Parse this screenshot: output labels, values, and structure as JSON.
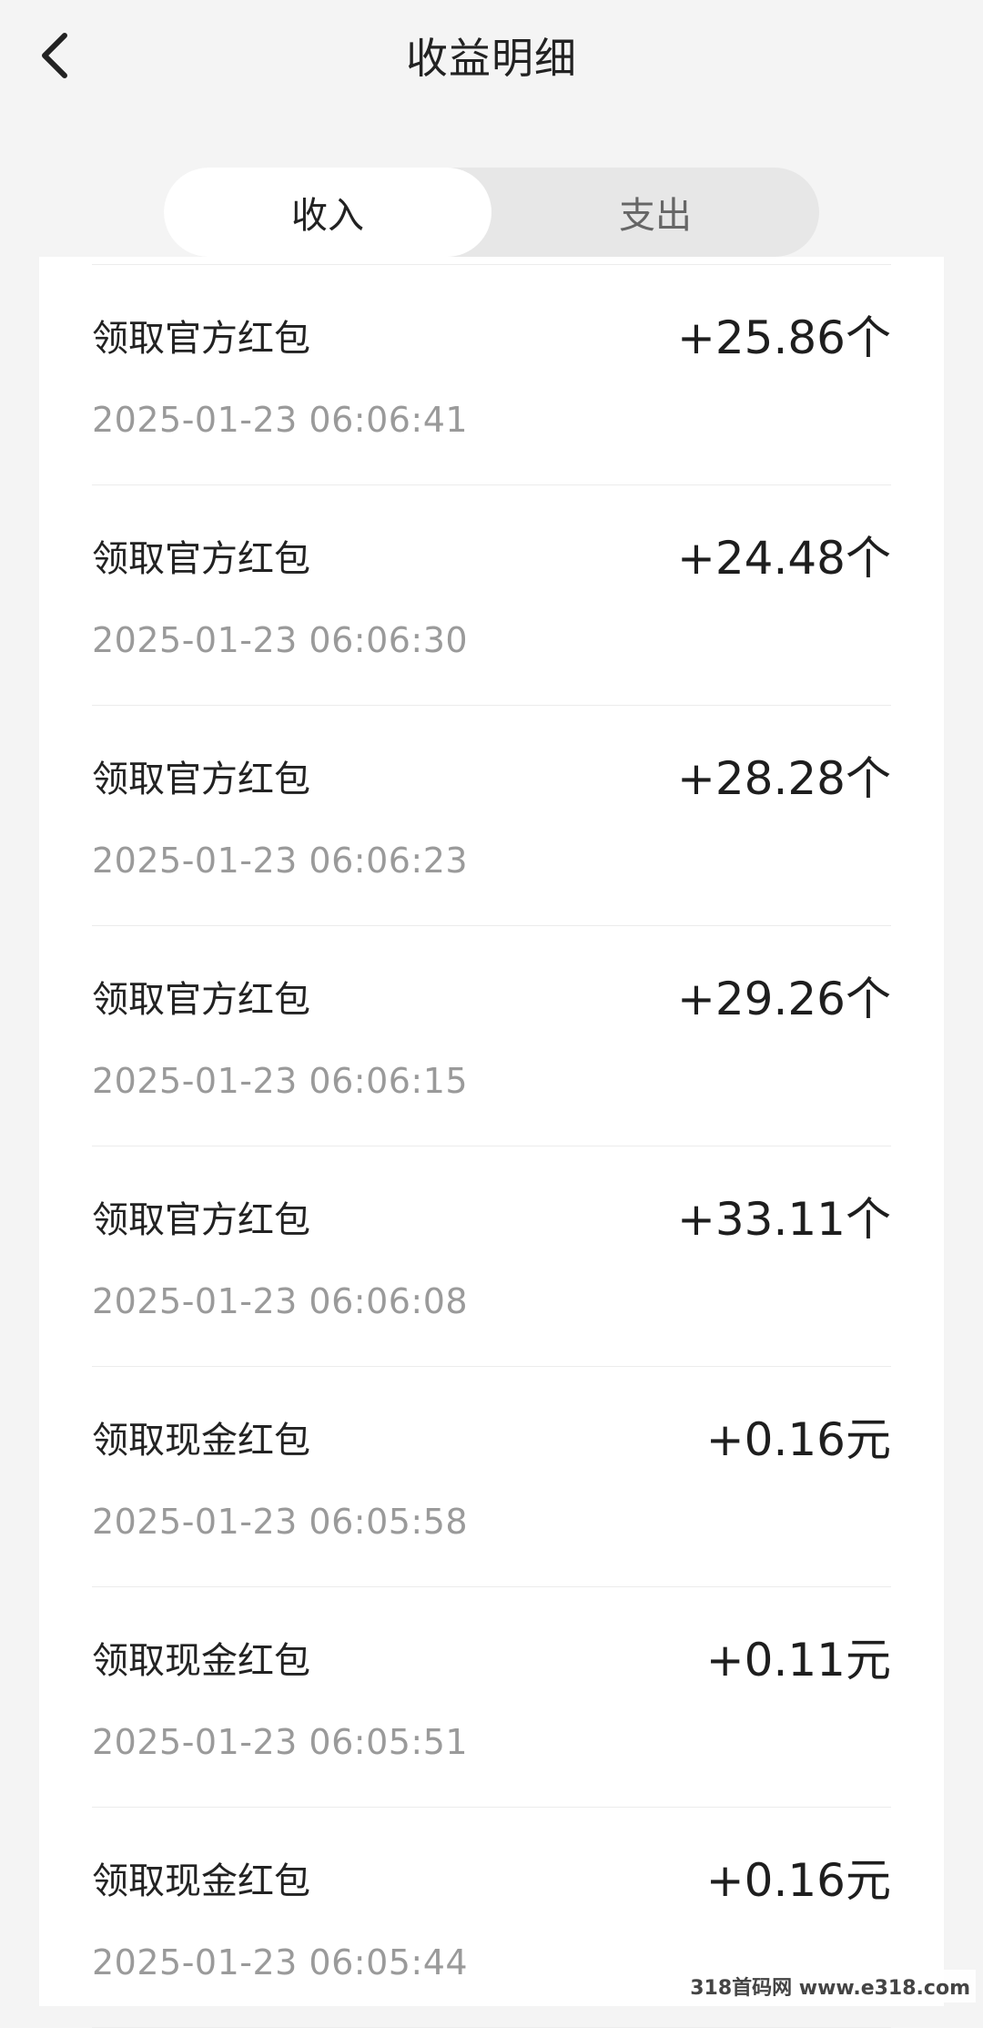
{
  "header": {
    "title": "收益明细",
    "back_icon": "chevron-left-icon"
  },
  "tabs": [
    {
      "label": "收入",
      "active": true
    },
    {
      "label": "支出",
      "active": false
    }
  ],
  "records": [
    {
      "title": "领取官方红包",
      "amount": "+25.86个",
      "time": "2025-01-23 06:06:41"
    },
    {
      "title": "领取官方红包",
      "amount": "+24.48个",
      "time": "2025-01-23 06:06:30"
    },
    {
      "title": "领取官方红包",
      "amount": "+28.28个",
      "time": "2025-01-23 06:06:23"
    },
    {
      "title": "领取官方红包",
      "amount": "+29.26个",
      "time": "2025-01-23 06:06:15"
    },
    {
      "title": "领取官方红包",
      "amount": "+33.11个",
      "time": "2025-01-23 06:06:08"
    },
    {
      "title": "领取现金红包",
      "amount": "+0.16元",
      "time": "2025-01-23 06:05:58"
    },
    {
      "title": "领取现金红包",
      "amount": "+0.11元",
      "time": "2025-01-23 06:05:51"
    },
    {
      "title": "领取现金红包",
      "amount": "+0.16元",
      "time": "2025-01-23 06:05:44"
    }
  ],
  "watermark": "318首码网 www.e318.com",
  "colors": {
    "background": "#f4f4f4",
    "card": "#ffffff",
    "tab_inactive_bg": "#e7e7e7",
    "time_text": "#9a9a9a"
  }
}
